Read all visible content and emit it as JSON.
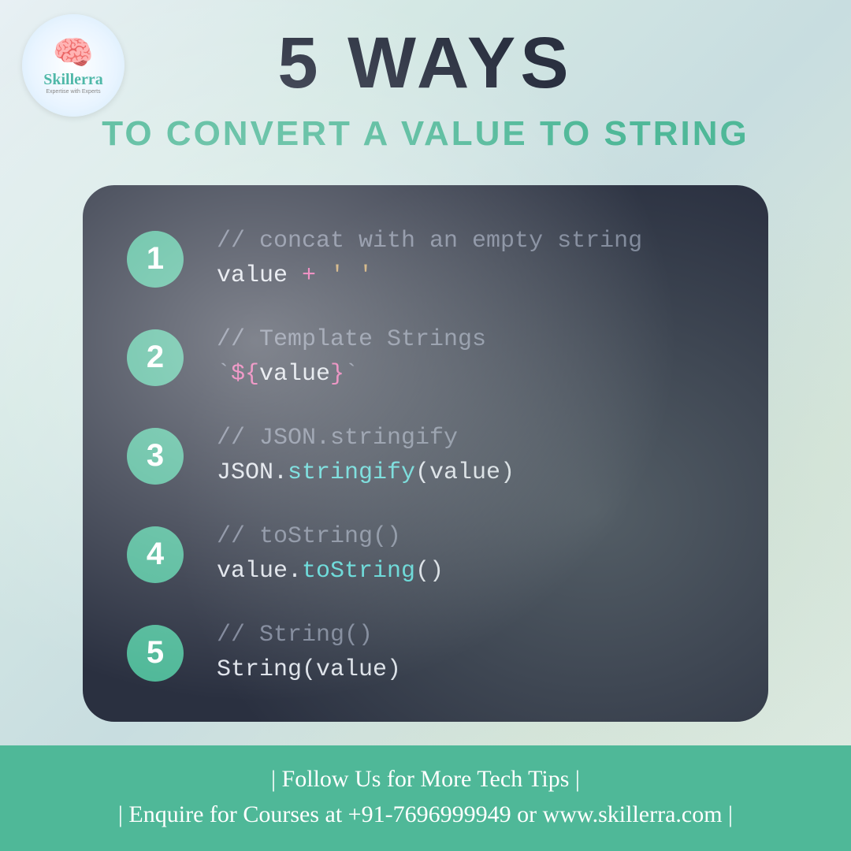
{
  "logo": {
    "brand": "Skillerra",
    "tagline": "Expertise with Experts"
  },
  "title": {
    "main": "5 WAYS",
    "sub": "TO CONVERT A VALUE TO STRING"
  },
  "items": [
    {
      "num": "1",
      "comment": "// concat with an empty string",
      "code_html": "<span class='c-val'>value </span><span class='c-op'>+</span><span class='c-str'> ' '</span>"
    },
    {
      "num": "2",
      "comment": "// Template Strings",
      "code_html": "<span class='c-tick'>`</span><span class='c-interp'>${</span><span class='c-val'>value</span><span class='c-interp'>}</span><span class='c-tick'>`</span>"
    },
    {
      "num": "3",
      "comment": "// JSON.stringify",
      "code_html": "<span class='c-val'>JSON.</span><span class='c-method'>stringify</span><span class='c-val'>(value)</span>"
    },
    {
      "num": "4",
      "comment": "// toString()",
      "code_html": "<span class='c-val'>value.</span><span class='c-method'>toString</span><span class='c-val'>()</span>"
    },
    {
      "num": "5",
      "comment": "// String()",
      "code_html": "<span class='c-val'>String(value)</span>"
    }
  ],
  "footer": {
    "line1": "| Follow Us for More Tech Tips |",
    "line2": "| Enquire for Courses at +91-7696999949 or www.skillerra.com |"
  }
}
